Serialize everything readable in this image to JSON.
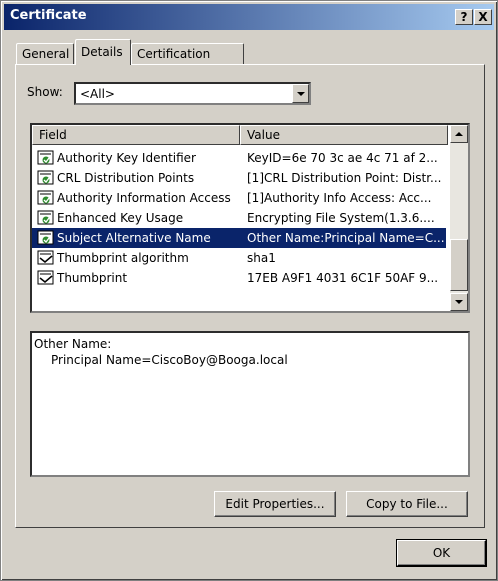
{
  "window": {
    "title": "Certificate",
    "help_label": "?",
    "close_label": "X"
  },
  "tabs": [
    {
      "label": "General"
    },
    {
      "label": "Details"
    },
    {
      "label": "Certification Path"
    }
  ],
  "show": {
    "label": "Show:",
    "value": "<All>"
  },
  "list": {
    "columns": {
      "field": "Field",
      "value": "Value"
    },
    "rows": [
      {
        "field": "Authority Key Identifier",
        "value": "KeyID=6e 70 3c ae 4c 71 af 2...",
        "icon": "extension-icon"
      },
      {
        "field": "CRL Distribution Points",
        "value": "[1]CRL Distribution Point: Distr...",
        "icon": "extension-icon"
      },
      {
        "field": "Authority Information Access",
        "value": "[1]Authority Info Access: Acc...",
        "icon": "extension-icon"
      },
      {
        "field": "Enhanced Key Usage",
        "value": "Encrypting File System(1.3.6....",
        "icon": "extension-icon"
      },
      {
        "field": "Subject Alternative Name",
        "value": "Other Name:Principal Name=C...",
        "icon": "extension-icon",
        "selected": true
      },
      {
        "field": "Thumbprint algorithm",
        "value": "sha1",
        "icon": "property-icon"
      },
      {
        "field": "Thumbprint",
        "value": "17EB A9F1 4031 6C1F 50AF 9...",
        "icon": "property-icon"
      }
    ]
  },
  "detail": {
    "line1": "Other Name:",
    "line2": "Principal Name=CiscoBoy@Booga.local"
  },
  "buttons": {
    "edit_properties": "Edit Properties...",
    "copy_to_file": "Copy to File...",
    "ok": "OK"
  },
  "colors": {
    "titlebar_start": "#0a246a",
    "titlebar_end": "#a6caf0",
    "selection": "#0a246a",
    "face": "#d4d0c8"
  }
}
